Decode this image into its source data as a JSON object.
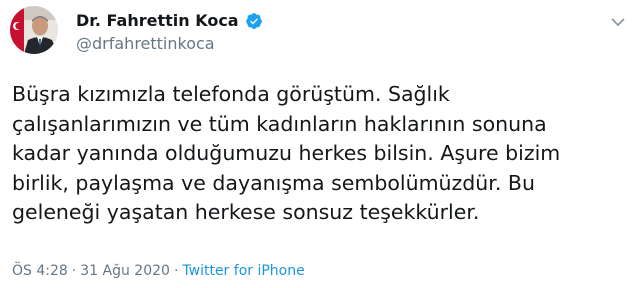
{
  "author": {
    "display_name": "Dr. Fahrettin Koca",
    "handle": "@drfahrettinkoca",
    "verified": true
  },
  "tweet": {
    "lines": [
      "Büşra kızımızla telefonda görüştüm. Sağlık",
      "çalışanlarımızın ve tüm kadınların haklarının sonuna",
      "kadar yanında olduğumuzu herkes bilsin. Aşure bizim",
      "birlik, paylaşma ve dayanışma sembolümüzdür. Bu",
      "geleneği yaşatan herkese sonsuz teşekkürler."
    ]
  },
  "meta": {
    "time": "ÖS 4:28",
    "separator": "·",
    "date": "31 Ağu 2020",
    "source": "Twitter for iPhone"
  },
  "icons": {
    "verified": "verified-badge-icon",
    "menu": "chevron-down-icon"
  },
  "colors": {
    "accent": "#1da1f2",
    "link": "#1b95e0",
    "secondary_text": "#657786",
    "primary_text": "#14171a"
  }
}
